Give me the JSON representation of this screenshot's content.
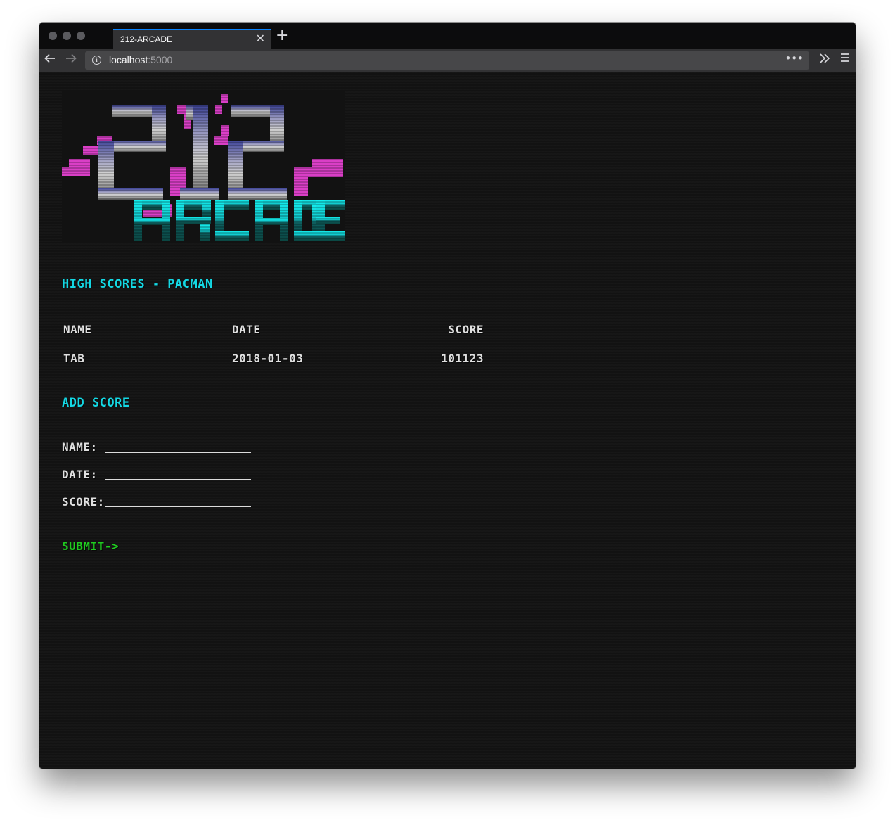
{
  "browser": {
    "tab_title": "212-ARCADE",
    "close_glyph": "✕",
    "new_tab_glyph": "+",
    "url_host": "localhost",
    "url_port": ":5000",
    "page_actions_glyph": "•••",
    "info_glyph": "i"
  },
  "logo": {
    "alt": "212 ARCADE",
    "colors": {
      "pink": "#d93fc6",
      "cyan": "#14e3e8",
      "teal": "#0e5e5a",
      "blue": "#3a3f9a",
      "gray": "#a9a9a9"
    }
  },
  "high_scores": {
    "heading": "HIGH SCORES - PACMAN",
    "columns": [
      "NAME",
      "DATE",
      "SCORE"
    ],
    "rows": [
      {
        "name": "TAB",
        "date": "2018-01-03",
        "score": "101123"
      }
    ]
  },
  "add_score": {
    "heading": "ADD SCORE",
    "name_label": "NAME:",
    "date_label": "DATE:",
    "score_label": "SCORE:",
    "name_value": "",
    "date_value": "",
    "score_value": "",
    "submit_label": "SUBMIT->"
  },
  "colors": {
    "background": "#121212",
    "heading": "#14d8e4",
    "submit": "#20cc20",
    "text": "#e0e0e0"
  }
}
